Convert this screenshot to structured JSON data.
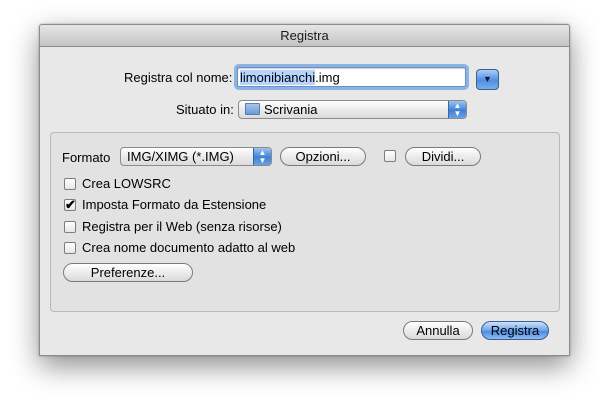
{
  "dialog": {
    "title": "Registra",
    "save_as": {
      "label": "Registra col nome:",
      "filename_selected": "limonibianchi",
      "filename_ext": ".img"
    },
    "location": {
      "label": "Situato in:",
      "value": "Scrivania"
    },
    "format": {
      "label": "Formato",
      "value": "IMG/XIMG (*.IMG)",
      "options_button": "Opzioni...",
      "split_button": "Dividi...",
      "split_checked": false
    },
    "checkboxes": [
      {
        "label": "Crea LOWSRC",
        "checked": false
      },
      {
        "label": "Imposta Formato da Estensione",
        "checked": true
      },
      {
        "label": "Registra per il Web (senza risorse)",
        "checked": false
      },
      {
        "label": "Crea nome documento adatto al web",
        "checked": false
      }
    ],
    "preferences_button": "Preferenze...",
    "cancel_button": "Annulla",
    "save_button": "Registra"
  }
}
